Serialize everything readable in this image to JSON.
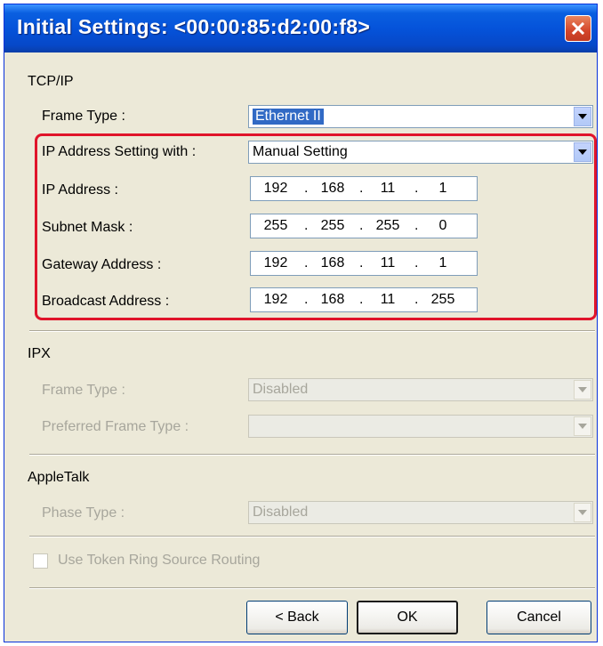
{
  "window": {
    "title": "Initial Settings: <00:00:85:d2:00:f8>"
  },
  "tcpip": {
    "section": "TCP/IP",
    "frame_type_label": "Frame Type :",
    "frame_type_value": "Ethernet II",
    "ip_setting_label": "IP Address Setting with :",
    "ip_setting_value": "Manual Setting",
    "ip_address_label": "IP Address :",
    "ip_address": [
      "192",
      "168",
      "11",
      "1"
    ],
    "subnet_label": "Subnet Mask :",
    "subnet": [
      "255",
      "255",
      "255",
      "0"
    ],
    "gateway_label": "Gateway Address :",
    "gateway": [
      "192",
      "168",
      "11",
      "1"
    ],
    "broadcast_label": "Broadcast Address :",
    "broadcast": [
      "192",
      "168",
      "11",
      "255"
    ]
  },
  "ipx": {
    "section": "IPX",
    "frame_type_label": "Frame Type :",
    "frame_type_value": "Disabled",
    "preferred_label": "Preferred Frame Type :",
    "preferred_value": ""
  },
  "appletalk": {
    "section": "AppleTalk",
    "phase_label": "Phase Type :",
    "phase_value": "Disabled"
  },
  "token_ring_label": "Use Token Ring Source Routing",
  "buttons": {
    "back": "< Back",
    "ok": "OK",
    "cancel": "Cancel"
  }
}
